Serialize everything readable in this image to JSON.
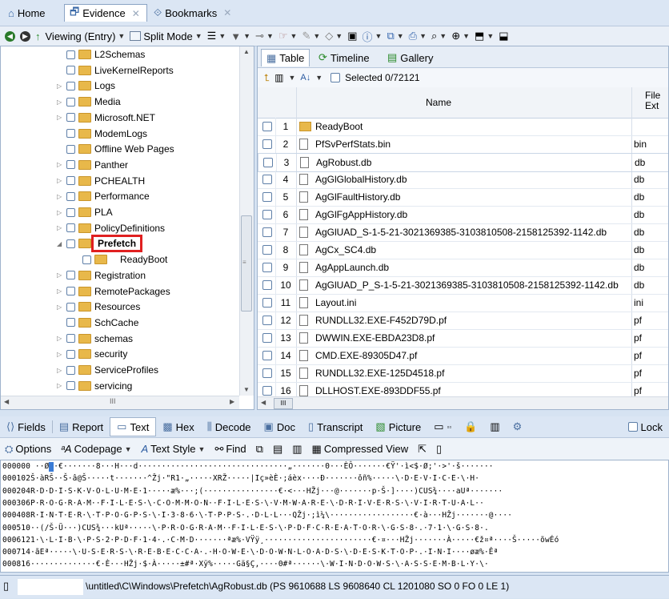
{
  "tabs": [
    {
      "label": "Home",
      "icon": "home-icon",
      "closable": false
    },
    {
      "label": "Evidence",
      "icon": "evidence-icon",
      "closable": true
    },
    {
      "label": "Bookmarks",
      "icon": "bookmarks-icon",
      "closable": true
    }
  ],
  "toolbar": {
    "viewing_label": "Viewing (Entry)",
    "split_mode_label": "Split Mode"
  },
  "tree": {
    "items": [
      {
        "label": "L2Schemas",
        "expandable": false,
        "indent": 1
      },
      {
        "label": "LiveKernelReports",
        "expandable": false,
        "indent": 1
      },
      {
        "label": "Logs",
        "expandable": true,
        "indent": 1
      },
      {
        "label": "Media",
        "expandable": true,
        "indent": 1
      },
      {
        "label": "Microsoft.NET",
        "expandable": true,
        "indent": 1
      },
      {
        "label": "ModemLogs",
        "expandable": false,
        "indent": 1
      },
      {
        "label": "Offline Web Pages",
        "expandable": false,
        "indent": 1
      },
      {
        "label": "Panther",
        "expandable": true,
        "indent": 1
      },
      {
        "label": "PCHEALTH",
        "expandable": true,
        "indent": 1
      },
      {
        "label": "Performance",
        "expandable": true,
        "indent": 1
      },
      {
        "label": "PLA",
        "expandable": true,
        "indent": 1
      },
      {
        "label": "PolicyDefinitions",
        "expandable": true,
        "indent": 1
      },
      {
        "label": "Prefetch",
        "expandable": true,
        "expanded": true,
        "indent": 1,
        "highlighted": true
      },
      {
        "label": "ReadyBoot",
        "expandable": false,
        "indent": 2
      },
      {
        "label": "Registration",
        "expandable": true,
        "indent": 1
      },
      {
        "label": "RemotePackages",
        "expandable": true,
        "indent": 1
      },
      {
        "label": "Resources",
        "expandable": true,
        "indent": 1
      },
      {
        "label": "SchCache",
        "expandable": false,
        "indent": 1
      },
      {
        "label": "schemas",
        "expandable": true,
        "indent": 1
      },
      {
        "label": "security",
        "expandable": true,
        "indent": 1
      },
      {
        "label": "ServiceProfiles",
        "expandable": true,
        "indent": 1
      },
      {
        "label": "servicing",
        "expandable": true,
        "indent": 1
      }
    ],
    "hscroll_label": "III"
  },
  "list": {
    "view_tabs": [
      "Table",
      "Timeline",
      "Gallery"
    ],
    "selected_text": "Selected 0/72121",
    "col_name": "Name",
    "col_ext": "File Ext",
    "hscroll_label": "III",
    "files": [
      {
        "num": "1",
        "name": "ReadyBoot",
        "ext": "",
        "folder": true
      },
      {
        "num": "2",
        "name": "PfSvPerfStats.bin",
        "ext": "bin"
      },
      {
        "num": "3",
        "name": "AgRobust.db",
        "ext": "db",
        "selected": true
      },
      {
        "num": "4",
        "name": "AgGlGlobalHistory.db",
        "ext": "db"
      },
      {
        "num": "5",
        "name": "AgGlFaultHistory.db",
        "ext": "db"
      },
      {
        "num": "6",
        "name": "AgGlFgAppHistory.db",
        "ext": "db"
      },
      {
        "num": "7",
        "name": "AgGlUAD_S-1-5-21-3021369385-3103810508-2158125392-1142.db",
        "ext": "db"
      },
      {
        "num": "8",
        "name": "AgCx_SC4.db",
        "ext": "db"
      },
      {
        "num": "9",
        "name": "AgAppLaunch.db",
        "ext": "db"
      },
      {
        "num": "10",
        "name": "AgGlUAD_P_S-1-5-21-3021369385-3103810508-2158125392-1142.db",
        "ext": "db"
      },
      {
        "num": "11",
        "name": "Layout.ini",
        "ext": "ini"
      },
      {
        "num": "12",
        "name": "RUNDLL32.EXE-F452D79D.pf",
        "ext": "pf"
      },
      {
        "num": "13",
        "name": "DWWIN.EXE-EBDA23D8.pf",
        "ext": "pf"
      },
      {
        "num": "14",
        "name": "CMD.EXE-89305D47.pf",
        "ext": "pf"
      },
      {
        "num": "15",
        "name": "RUNDLL32.EXE-125D4518.pf",
        "ext": "pf"
      },
      {
        "num": "16",
        "name": "DLLHOST.EXE-893DDF55.pf",
        "ext": "pf"
      }
    ]
  },
  "bottom_tabs": [
    "Fields",
    "Report",
    "Text",
    "Hex",
    "Decode",
    "Doc",
    "Transcript",
    "Picture",
    "Lock"
  ],
  "bottom_tools": {
    "options": "Options",
    "codepage": "Codepage",
    "text_style": "Text Style",
    "find": "Find",
    "compressed_view": "Compressed View"
  },
  "hex_rows": [
    {
      "offset": "000000",
      "text": " ··Ø^·€·······8···H···d································„·······Θ···ÈÔ·······€Ÿ'·ì<$·Ø;'·>'·š·······"
    },
    {
      "offset": "000102",
      "text": "Š·àRŠ··Š·â@Š·····t·······^Žj·\"R1·„·····XRŽ·····|Iç»èÈ·;áèx····Ð·······ǒñ%·····\\·D·E·V·I·C·E·\\·H·"
    },
    {
      "offset": "000204",
      "text": "R·D·D·I·S·K·V·O·L·U·M·E·1·····æ%···;(················€·<···HŽj···@·······p·Š·]····)CUS¾····aUª·······"
    },
    {
      "offset": "000306",
      "text": "P·R·O·G·R·A·M··F·I·L·E·S·\\·C·O·M·M·O·N··F·I·L·E·S·\\·V·M·W·A·R·E·\\·D·R·I·V·E·R·S·\\·V·I·R·T·U·A·L··"
    },
    {
      "offset": "000408",
      "text": "R·I·N·T·E·R·\\·T·P·O·G·P·S·\\·I·3·8·6·\\·T·P·P·S·.·D·L·L···QŽj·;ì¼\\··················€·à···HŽj·······@····"
    },
    {
      "offset": "000510",
      "text": "··(/Š·Ü···)CUS¾···kUª·····\\·P·R·O·G·R·A·M··F·I·L·E·S·\\·P·D·F·C·R·E·A·T·O·R·\\·G·S·8·.·7·1·\\·G·S·8·."
    },
    {
      "offset": "000612",
      "text": "1·\\·L·I·B·\\·P·S·2·P·D·F·1·4·.·C·M·D·······ªæ%·VŸÿ¸·······················€·¤···HŽj·······À·····€ž¤ª····Š·····õwÉó"
    },
    {
      "offset": "000714",
      "text": "·ãEª·····\\·U·S·E·R·S·\\·R·E·B·E·C·C·A·.·H·O·W·E·\\·D·O·W·N·L·O·A·D·S·\\·D·E·S·K·T·O·P·.·I·N·I····øæ%·Êª"
    },
    {
      "offset": "000816",
      "text": "··············€·È···HŽj·$·À·····±#ª·Xÿ%·····Gä§Ç,····Θ#ª······\\·W·I·N·D·O·W·S·\\·A·S·S·E·M·B·L·Y·\\·"
    }
  ],
  "status": {
    "path": "\\untitled\\C\\Windows\\Prefetch\\AgRobust.db (PS 9610688 LS 9608640 CL 1201080 SO 0 FO 0 LE 1)"
  },
  "colors": {
    "highlight_box": "#e02020",
    "folder": "#e8b84a",
    "hex_cursor": "#3a7bd5"
  }
}
